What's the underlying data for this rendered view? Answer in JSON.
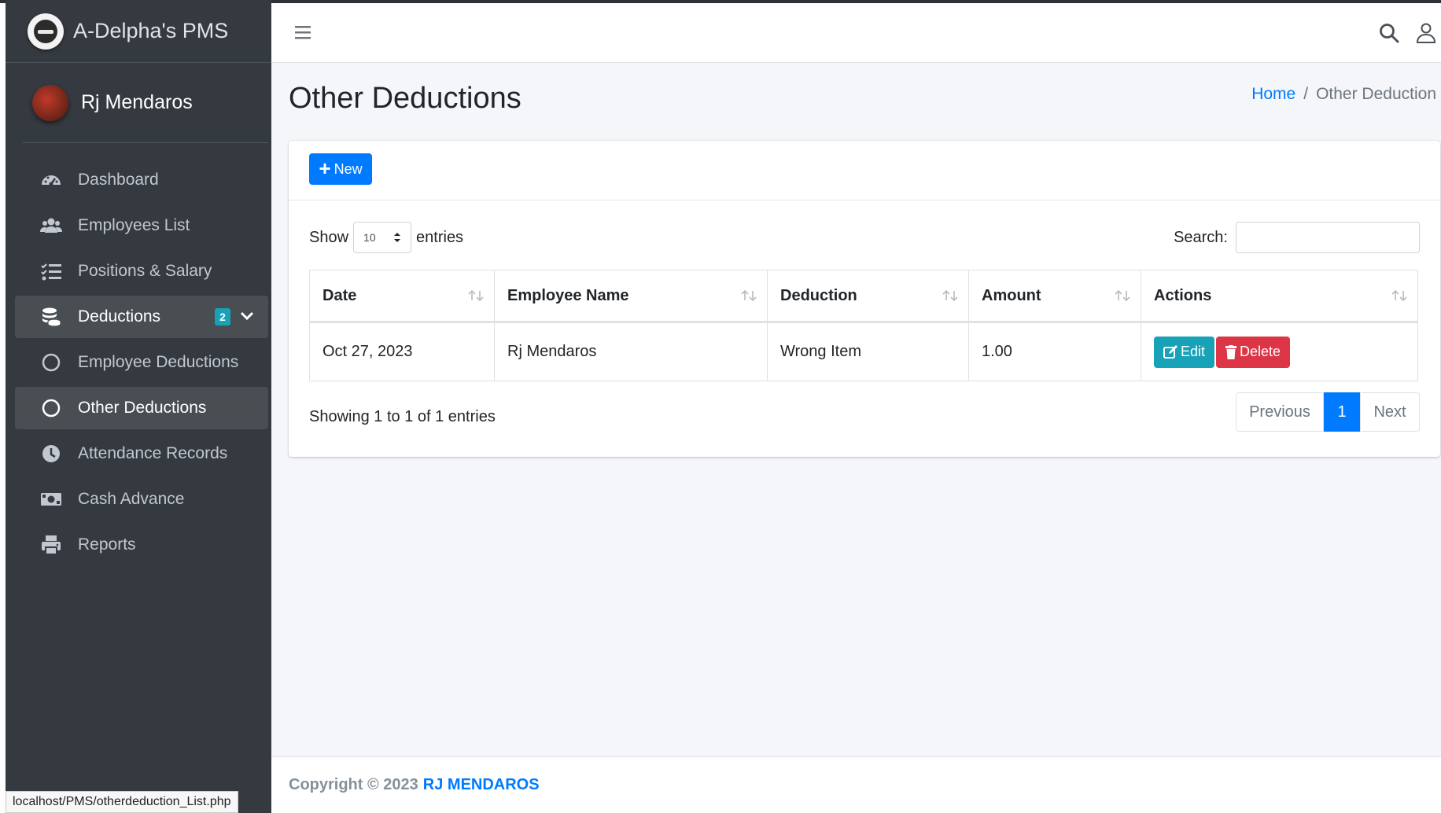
{
  "brand": {
    "title": "A-Delpha's PMS"
  },
  "user": {
    "name": "Rj Mendaros"
  },
  "sidebar": {
    "items": [
      {
        "label": "Dashboard"
      },
      {
        "label": "Employees List"
      },
      {
        "label": "Positions & Salary"
      },
      {
        "label": "Deductions",
        "badge": "2"
      },
      {
        "label": "Employee Deductions"
      },
      {
        "label": "Other Deductions"
      },
      {
        "label": "Attendance Records"
      },
      {
        "label": "Cash Advance"
      },
      {
        "label": "Reports"
      }
    ]
  },
  "page": {
    "title": "Other Deductions"
  },
  "breadcrumb": {
    "home": "Home",
    "separator": "/",
    "current": "Other Deduction"
  },
  "toolbar": {
    "new_label": "New"
  },
  "table_controls": {
    "show_label": "Show",
    "entries_label": "entries",
    "length_value": "10",
    "search_label": "Search:"
  },
  "table": {
    "headers": [
      "Date",
      "Employee Name",
      "Deduction",
      "Amount",
      "Actions"
    ],
    "rows": [
      {
        "date": "Oct 27, 2023",
        "employee": "Rj Mendaros",
        "deduction": "Wrong Item",
        "amount": "1.00",
        "edit": "Edit",
        "delete": "Delete"
      }
    ]
  },
  "pagination": {
    "info": "Showing 1 to 1 of 1 entries",
    "previous": "Previous",
    "page": "1",
    "next": "Next"
  },
  "footer": {
    "copyright": "Copyright © 2023",
    "author": "RJ MENDAROS"
  },
  "status_bar": {
    "url": "localhost/PMS/otherdeduction_List.php"
  },
  "colors": {
    "primary": "#007bff",
    "info": "#17a2b8",
    "danger": "#dc3545",
    "sidebar": "#343a40"
  }
}
